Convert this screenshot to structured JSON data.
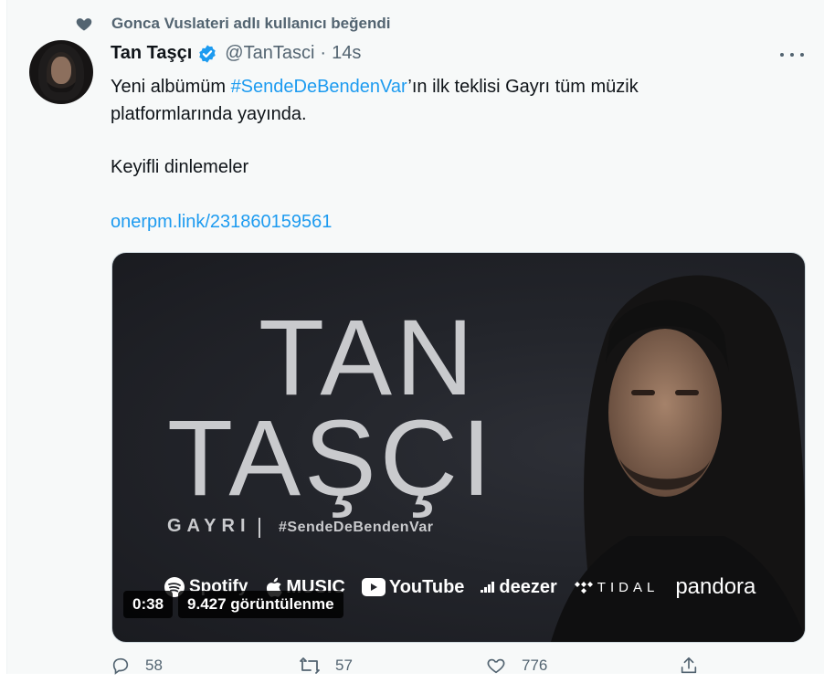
{
  "social_context": {
    "text": "Gonca Vuslateri adlı kullanıcı beğendi",
    "icon": "heart-icon"
  },
  "tweet": {
    "author_name": "Tan Taşçı",
    "verified_icon": "verified-badge-icon",
    "handle": "@TanTasci",
    "separator": "·",
    "time": "14s",
    "more_icon": "more-options-icon",
    "text_line1_before": "Yeni albümüm ",
    "text_hashtag": "#SendeDeBendenVar",
    "text_line1_after": "’ın ilk teklisi Gayrı tüm müzik",
    "text_line2": "platformlarında yayında.",
    "text_line3": "Keyifli dinlemeler",
    "link": "onerpm.link/231860159561"
  },
  "media": {
    "title_line1": "TAN",
    "title_line2": "TAŞÇI",
    "subtitle": "GAYRI",
    "hashtag": "#SendeDeBendenVar",
    "platforms": [
      "Spotify",
      "MUSIC",
      "YouTube",
      "deezer",
      "TIDAL",
      "pandora"
    ],
    "duration": "0:38",
    "views": "9.427 görüntülenme"
  },
  "actions": {
    "reply_count": "58",
    "retweet_count": "57",
    "like_count": "776"
  },
  "colors": {
    "accent": "#1d9bf0",
    "muted": "#536471",
    "background": "#f7f9f9"
  }
}
